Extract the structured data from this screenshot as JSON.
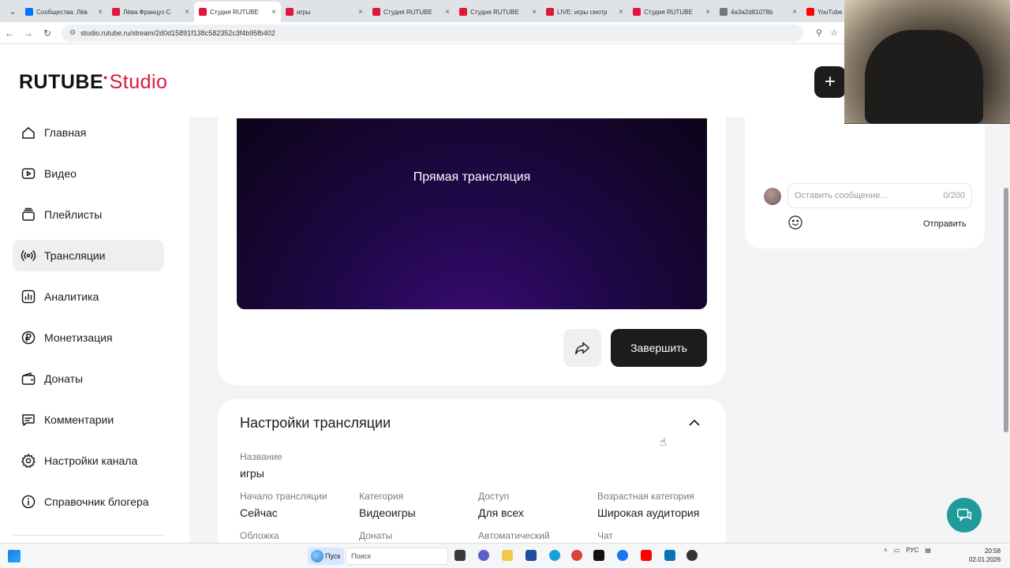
{
  "browser": {
    "tabs": [
      {
        "title": "Сообщества: Лёв",
        "color": "#0077ff",
        "active": false
      },
      {
        "title": "Лёва Француз С",
        "color": "#e0173a",
        "active": false
      },
      {
        "title": "Студия RUTUBE",
        "color": "#e0173a",
        "active": true
      },
      {
        "title": "игры",
        "color": "#e0173a",
        "active": false
      },
      {
        "title": "Студия RUTUBE",
        "color": "#e0173a",
        "active": false
      },
      {
        "title": "Студия RUTUBE",
        "color": "#e0173a",
        "active": false
      },
      {
        "title": "LIVE: игры смотр",
        "color": "#e0173a",
        "active": false
      },
      {
        "title": "Студия RUTUBE",
        "color": "#e0173a",
        "active": false
      },
      {
        "title": "4a3a2d81078b",
        "color": "#777777",
        "active": false
      },
      {
        "title": "YouTube",
        "color": "#ff0000",
        "active": false
      }
    ],
    "url": "studio.rutube.ru/stream/2d0d15891f138c582352c3f4b95fb402"
  },
  "header": {
    "logo_main": "RUTUBE",
    "logo_studio": "Studio",
    "add_label": "+"
  },
  "sidebar": {
    "items": [
      {
        "label": "Главная",
        "icon": "home-icon",
        "active": false
      },
      {
        "label": "Видео",
        "icon": "video-icon",
        "active": false
      },
      {
        "label": "Плейлисты",
        "icon": "playlist-icon",
        "active": false
      },
      {
        "label": "Трансляции",
        "icon": "broadcast-icon",
        "active": true
      },
      {
        "label": "Аналитика",
        "icon": "analytics-icon",
        "active": false
      },
      {
        "label": "Монетизация",
        "icon": "ruble-icon",
        "active": false
      },
      {
        "label": "Донаты",
        "icon": "wallet-icon",
        "active": false
      },
      {
        "label": "Комментарии",
        "icon": "comment-icon",
        "active": false
      },
      {
        "label": "Настройки канала",
        "icon": "gear-icon",
        "active": false
      },
      {
        "label": "Справочник блогера",
        "icon": "info-icon",
        "active": false
      }
    ]
  },
  "player": {
    "title": "Прямая трансляция"
  },
  "actions": {
    "finish_label": "Завершить"
  },
  "settings": {
    "title": "Настройки трансляции",
    "name_label": "Название",
    "name_value": "игры",
    "fields": [
      {
        "label": "Начало трансляции",
        "value": "Сейчас"
      },
      {
        "label": "Категория",
        "value": "Видеоигры"
      },
      {
        "label": "Доступ",
        "value": "Для всех"
      },
      {
        "label": "Возрастная категория",
        "value": "Широкая аудитория"
      },
      {
        "label": "Обложка",
        "value": ""
      },
      {
        "label": "Донаты",
        "value": ""
      },
      {
        "label": "Автоматический",
        "value": ""
      },
      {
        "label": "Чат",
        "value": ""
      }
    ]
  },
  "chat": {
    "placeholder": "Оставить сообщение...",
    "counter": "0/200",
    "send_label": "Отправить"
  },
  "taskbar": {
    "start_label": "Пуск",
    "search_placeholder": "Поиск",
    "language": "РУС",
    "time": "20:58",
    "date": "02.01.2026"
  },
  "colors": {
    "brand_red": "#e0173a",
    "dark_button": "#1c1c1e",
    "help_button": "#1f9c9a"
  }
}
